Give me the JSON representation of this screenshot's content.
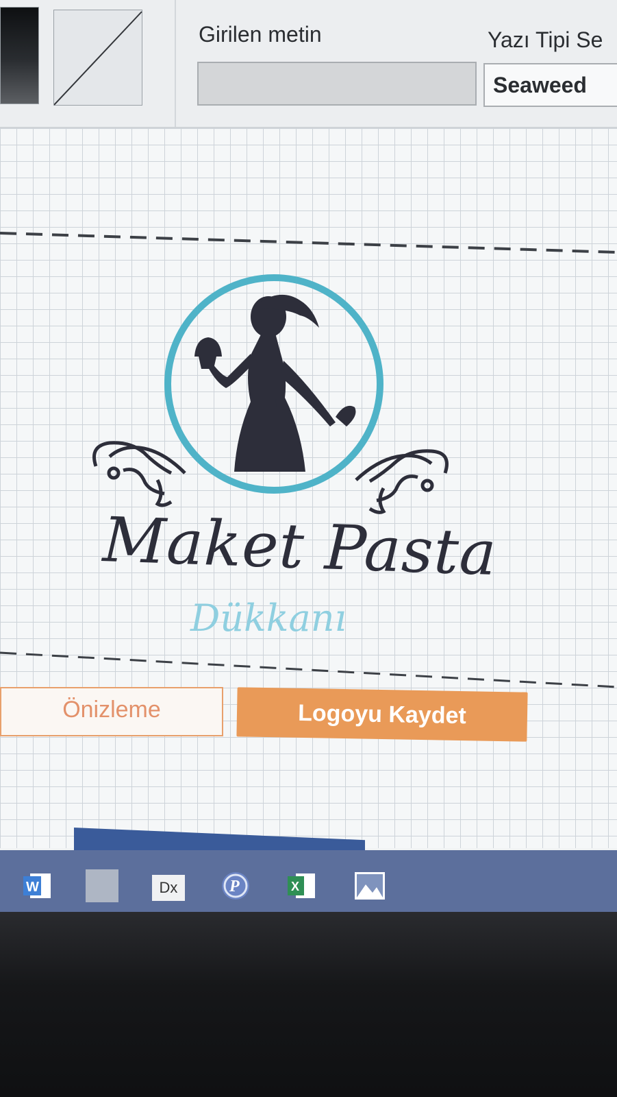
{
  "toolbar": {
    "text_label": "Girilen metin",
    "text_value": "",
    "font_label": "Yazı Tipi Se",
    "font_value": "Seaweed"
  },
  "logo": {
    "title": "Maket Pasta",
    "subtitle": "Dükkanı",
    "circle_color": "#4fb3c8",
    "silhouette_color": "#2d2e3a"
  },
  "actions": {
    "preview_label": "Önizleme",
    "save_label": "Logoyu Kaydet"
  },
  "taskbar": {
    "apps": [
      "word-icon",
      "blank-app-icon",
      "dx-icon",
      "p-icon",
      "excel-icon",
      "photos-icon"
    ],
    "dx_label": "Dx"
  }
}
